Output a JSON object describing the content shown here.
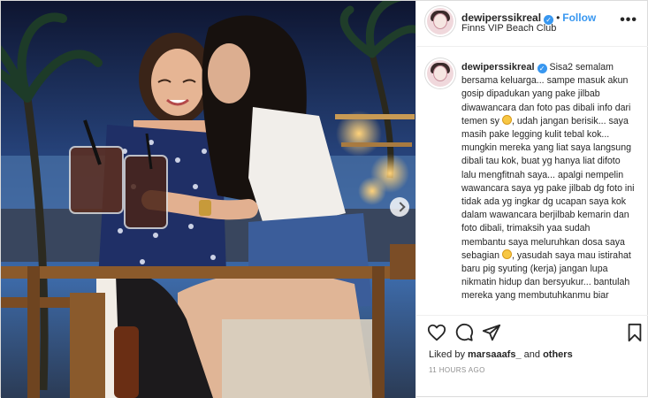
{
  "post": {
    "username": "dewiperssikreal",
    "follow_label": "Follow",
    "location": "Finns VIP Beach Club",
    "more_label": "•••",
    "caption_parts": {
      "p1": "Sisa2 semalam bersama keluarga... sampe masuk akun gosip dipadukan yang pake jilbab diwawancara dan foto pas dibali info dari temen sy ",
      "p2": ", udah jangan berisik... saya masih pake legging kulit tebal kok... mungkin mereka yang liat saya langsung dibali tau kok, buat yg hanya liat difoto lalu mengfitnah saya... apalgi nempelin wawancara saya yg pake jilbab dg foto ini tidak ada yg ingkar dg ucapan saya kok dalam wawancara berjilbab kemarin dan foto dibali, trimaksih yaa sudah membantu saya meluruhkan dosa saya sebagian ",
      "p3": ", yasudah saya mau istirahat baru pig syuting (kerja) jangan lupa nikmatin hidup dan bersyukur... bantulah mereka yang membutuhkanmu biar"
    },
    "emoji_name": "smiling-face-emoji",
    "likes_prefix": "Liked by ",
    "liked_by_user": "marsaaafs_",
    "likes_and": " and ",
    "likes_others": "others",
    "time_ago": "11 HOURS AGO"
  },
  "icons": {
    "verified": "verified-badge-icon",
    "like": "heart-icon",
    "comment": "comment-icon",
    "share": "paper-plane-icon",
    "save": "bookmark-icon",
    "next": "chevron-right-icon"
  },
  "colors": {
    "accent": "#3897f0",
    "text": "#262626",
    "muted": "#8e8e8e",
    "border": "#dbdbdb"
  }
}
